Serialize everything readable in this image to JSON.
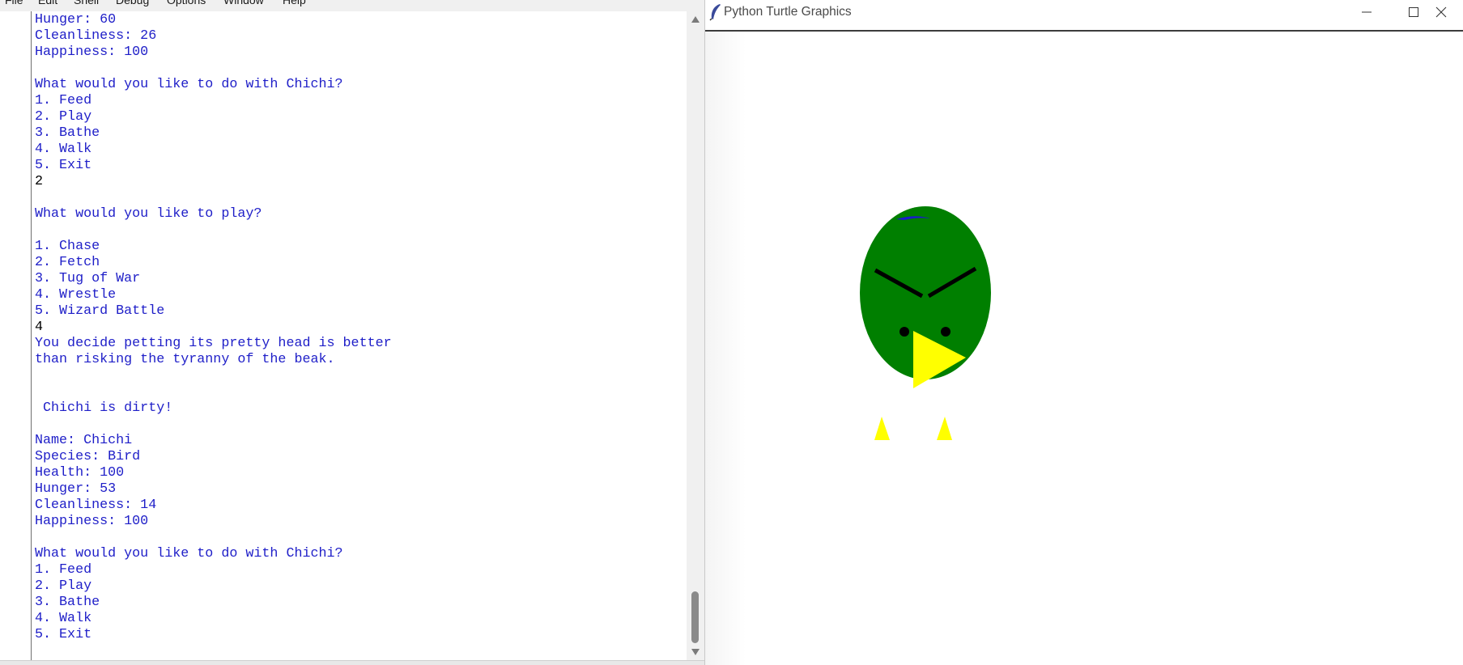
{
  "shell": {
    "menu": [
      "File",
      "Edit",
      "Shell",
      "Debug",
      "Options",
      "Window",
      "Help"
    ],
    "lines": [
      {
        "text": "Hunger: 60",
        "kind": "out"
      },
      {
        "text": "Cleanliness: 26",
        "kind": "out"
      },
      {
        "text": "Happiness: 100",
        "kind": "out"
      },
      {
        "text": "",
        "kind": "out"
      },
      {
        "text": "What would you like to do with Chichi?",
        "kind": "out"
      },
      {
        "text": "1. Feed",
        "kind": "out"
      },
      {
        "text": "2. Play",
        "kind": "out"
      },
      {
        "text": "3. Bathe",
        "kind": "out"
      },
      {
        "text": "4. Walk",
        "kind": "out"
      },
      {
        "text": "5. Exit",
        "kind": "out"
      },
      {
        "text": "2",
        "kind": "inp"
      },
      {
        "text": "",
        "kind": "out"
      },
      {
        "text": "What would you like to play?",
        "kind": "out"
      },
      {
        "text": "",
        "kind": "out"
      },
      {
        "text": "1. Chase",
        "kind": "out"
      },
      {
        "text": "2. Fetch",
        "kind": "out"
      },
      {
        "text": "3. Tug of War",
        "kind": "out"
      },
      {
        "text": "4. Wrestle",
        "kind": "out"
      },
      {
        "text": "5. Wizard Battle",
        "kind": "out"
      },
      {
        "text": "4",
        "kind": "inp"
      },
      {
        "text": "You decide petting its pretty head is better",
        "kind": "out"
      },
      {
        "text": "than risking the tyranny of the beak.",
        "kind": "out"
      },
      {
        "text": "",
        "kind": "out"
      },
      {
        "text": "",
        "kind": "out"
      },
      {
        "text": " Chichi is dirty!",
        "kind": "out"
      },
      {
        "text": "",
        "kind": "out"
      },
      {
        "text": "Name: Chichi",
        "kind": "out"
      },
      {
        "text": "Species: Bird",
        "kind": "out"
      },
      {
        "text": "Health: 100",
        "kind": "out"
      },
      {
        "text": "Hunger: 53",
        "kind": "out"
      },
      {
        "text": "Cleanliness: 14",
        "kind": "out"
      },
      {
        "text": "Happiness: 100",
        "kind": "out"
      },
      {
        "text": "",
        "kind": "out"
      },
      {
        "text": "What would you like to do with Chichi?",
        "kind": "out"
      },
      {
        "text": "1. Feed",
        "kind": "out"
      },
      {
        "text": "2. Play",
        "kind": "out"
      },
      {
        "text": "3. Bathe",
        "kind": "out"
      },
      {
        "text": "4. Walk",
        "kind": "out"
      },
      {
        "text": "5. Exit",
        "kind": "out"
      }
    ],
    "colors": {
      "output": "#1e1ec8",
      "input": "#000000"
    }
  },
  "turtle_window": {
    "title": "Python Turtle Graphics",
    "title_icon": "feather-icon",
    "controls": [
      "minimize-icon",
      "maximize-icon",
      "close-icon"
    ],
    "bird_colors": {
      "body": "#007f00",
      "beak": "#ffff00",
      "feet": "#ffff00",
      "brows": "#000000",
      "tuft": "#1a1acc"
    }
  }
}
